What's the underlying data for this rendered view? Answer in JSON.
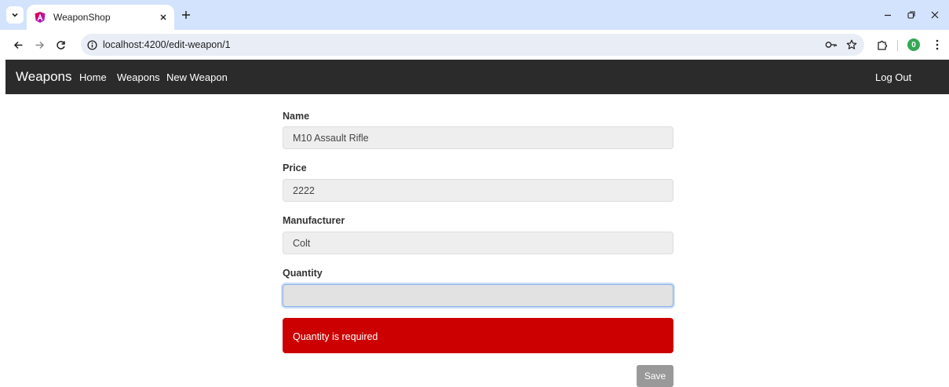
{
  "browser": {
    "tab": {
      "title": "WeaponShop"
    },
    "url": "localhost:4200/edit-weapon/1",
    "profile_initial": "0"
  },
  "navbar": {
    "brand": "Weapons",
    "links": [
      "Home",
      "Weapons",
      "New Weapon"
    ],
    "logout": "Log Out"
  },
  "form": {
    "name": {
      "label": "Name",
      "value": "M10 Assault Rifle"
    },
    "price": {
      "label": "Price",
      "value": "2222"
    },
    "manufacturer": {
      "label": "Manufacturer",
      "value": "Colt"
    },
    "quantity": {
      "label": "Quantity",
      "value": ""
    },
    "error": "Quantity is required",
    "save_label": "Save"
  },
  "colors": {
    "navbar_bg": "#2b2b2b",
    "error_bg": "#cc0000",
    "save_bg": "#999999",
    "tabstrip_bg": "#d3e3fd"
  },
  "icons": {
    "tab_list": "chevron-down-icon",
    "favicon": "angular-logo-icon",
    "close": "close-icon",
    "new_tab": "plus-icon",
    "back": "arrow-left-icon",
    "forward": "arrow-right-icon",
    "reload": "reload-icon",
    "site_info": "info-icon",
    "password": "key-icon",
    "bookmark": "star-icon",
    "extensions": "puzzle-icon",
    "menu": "kebab-menu-icon"
  }
}
